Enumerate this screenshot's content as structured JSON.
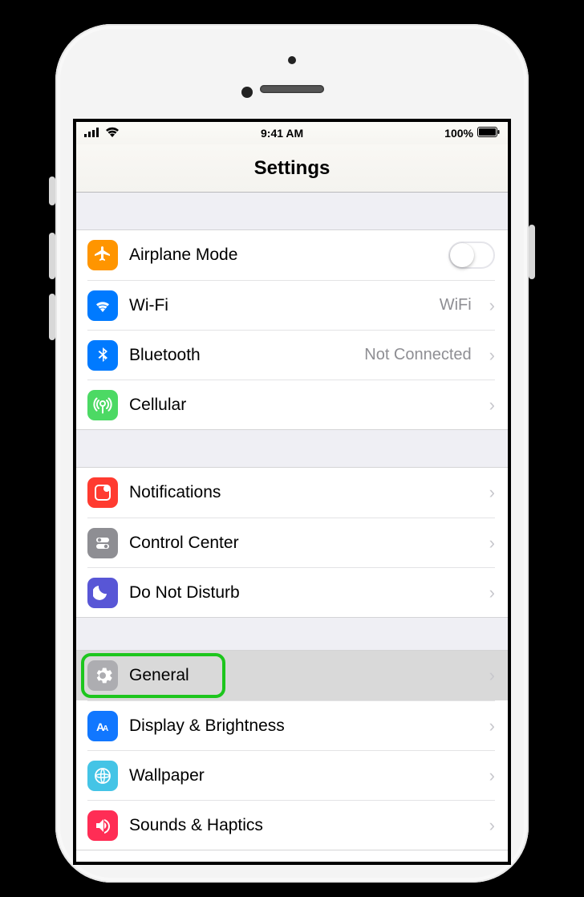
{
  "statusbar": {
    "time": "9:41 AM",
    "battery": "100%"
  },
  "header": {
    "title": "Settings"
  },
  "groups": [
    {
      "rows": [
        {
          "icon": "airplane-icon",
          "label": "Airplane Mode",
          "control": "toggle"
        },
        {
          "icon": "wifi-icon",
          "label": "Wi-Fi",
          "value": "WiFi",
          "control": "chevron"
        },
        {
          "icon": "bluetooth-icon",
          "label": "Bluetooth",
          "value": "Not Connected",
          "control": "chevron"
        },
        {
          "icon": "cellular-icon",
          "label": "Cellular",
          "control": "chevron"
        }
      ]
    },
    {
      "rows": [
        {
          "icon": "notifications-icon",
          "label": "Notifications",
          "control": "chevron"
        },
        {
          "icon": "control-center-icon",
          "label": "Control Center",
          "control": "chevron"
        },
        {
          "icon": "do-not-disturb-icon",
          "label": "Do Not Disturb",
          "control": "chevron"
        }
      ]
    },
    {
      "rows": [
        {
          "icon": "general-icon",
          "label": "General",
          "control": "chevron",
          "selected": true,
          "highlighted": true
        },
        {
          "icon": "display-icon",
          "label": "Display & Brightness",
          "control": "chevron"
        },
        {
          "icon": "wallpaper-icon",
          "label": "Wallpaper",
          "control": "chevron"
        },
        {
          "icon": "sounds-icon",
          "label": "Sounds & Haptics",
          "control": "chevron"
        }
      ]
    }
  ]
}
